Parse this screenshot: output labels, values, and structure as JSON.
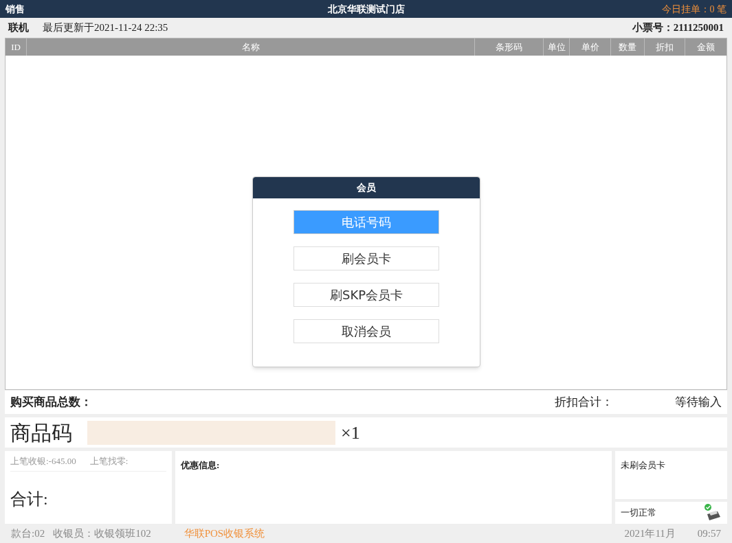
{
  "title_bar": {
    "mode": "销售",
    "store": "北京华联测试门店",
    "pending": "今日挂单：0 笔"
  },
  "info_bar": {
    "status": "联机",
    "updated": "最后更新于2021-11-24 22:35",
    "receipt": "小票号：2111250001"
  },
  "table": {
    "columns": [
      "ID",
      "名称",
      "条形码",
      "单位",
      "单价",
      "数量",
      "折扣",
      "金额"
    ]
  },
  "dialog": {
    "title": "会员",
    "options": [
      {
        "label": "电话号码",
        "selected": true
      },
      {
        "label": "刷会员卡",
        "selected": false
      },
      {
        "label": "刷SKP会员卡",
        "selected": false
      },
      {
        "label": "取消会员",
        "selected": false
      }
    ]
  },
  "summary": {
    "total_items": "购买商品总数：",
    "discount_total": "折扣合计：",
    "waiting": "等待输入"
  },
  "entry": {
    "label": "商品码",
    "multiplier": "×1"
  },
  "last_sale": {
    "received": "上笔收银:-645.00",
    "change": "上笔找零:",
    "total": "合计:"
  },
  "promo": {
    "label": "优惠信息:"
  },
  "member": {
    "status": "未刷会员卡"
  },
  "printer": {
    "status": "一切正常"
  },
  "status_bar": {
    "register": "款台:02",
    "cashier": "收银员：收银领班102",
    "system": "华联POS收银系统",
    "date": "2021年11月",
    "time": "09:57"
  }
}
